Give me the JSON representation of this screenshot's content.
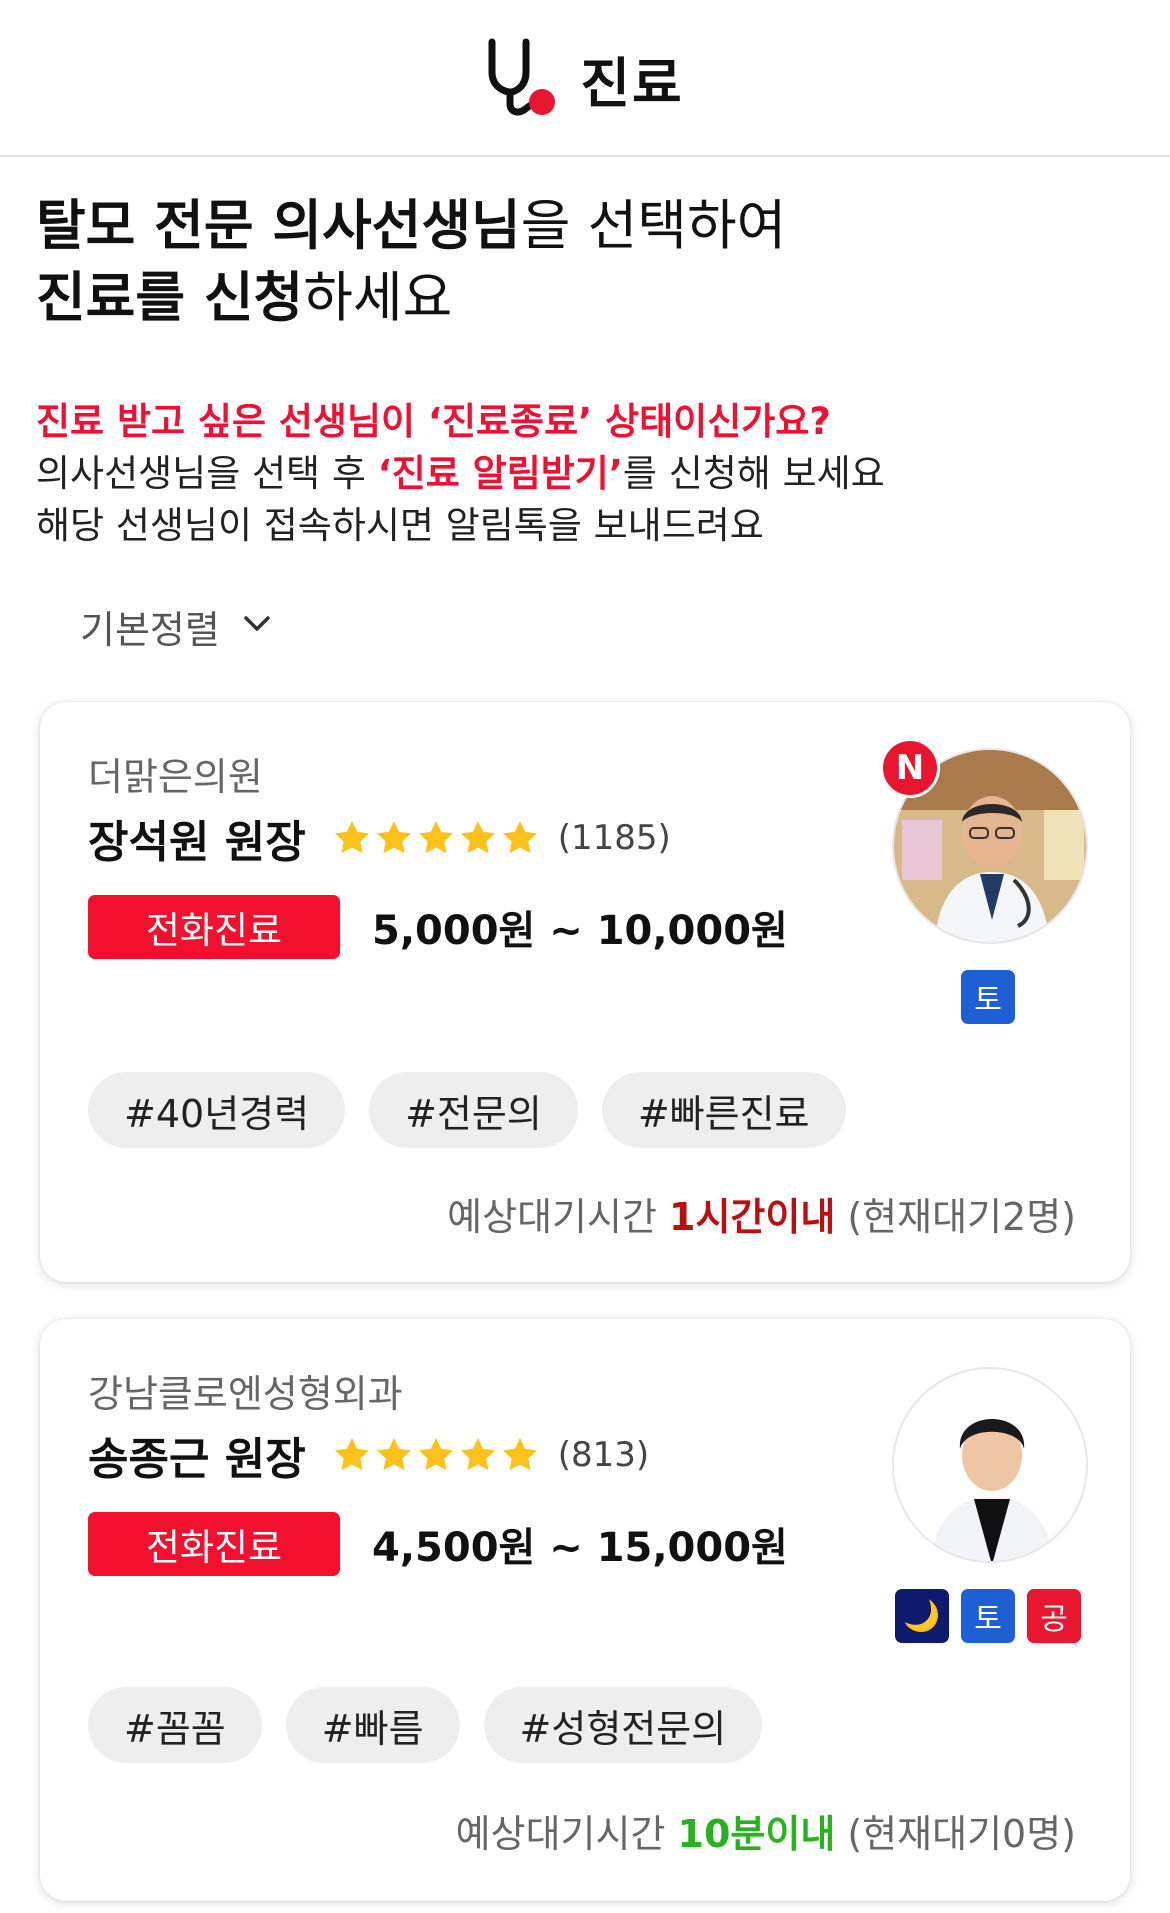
{
  "header": {
    "title": "진료",
    "logo_icon": "stethoscope-icon",
    "accent": "#e8172f"
  },
  "intro": {
    "line1_bold": "탈모 전문 의사선생님",
    "line1_rest": "을 선택하여",
    "line2_bold": "진료를 신청",
    "line2_rest": "하세요"
  },
  "notice": {
    "line1": "진료 받고 싶은 선생님이 ‘진료종료’ 상태이신가요?",
    "line2_pre": "의사선생님을 선택 후 ",
    "line2_highlight": "‘진료 알림받기’",
    "line2_post": "를 신청해 보세요",
    "line3": "해당 선생님이 접속하시면 알림톡을 보내드려요"
  },
  "sort": {
    "label": "기본정렬",
    "icon": "chevron-down-icon"
  },
  "doctors": [
    {
      "clinic": "더맑은의원",
      "name": "장석원 원장",
      "rating_stars": 5,
      "rating_count": "(1185)",
      "consult_type": "전화진료",
      "price": "5,000원 ~ 10,000원",
      "new_badge": "N",
      "days": [
        "토"
      ],
      "tags": [
        "#40년경력",
        "#전문의",
        "#빠른진료"
      ],
      "wait_label": "예상대기시간 ",
      "wait_value": "1시간이내",
      "wait_queue": " (현재대기2명)"
    },
    {
      "clinic": "강남클로엔성형외과",
      "name": "송종근 원장",
      "rating_stars": 5,
      "rating_count": "(813)",
      "consult_type": "전화진료",
      "price": "4,500원 ~ 15,000원",
      "days": [
        "🌙",
        "토",
        "공"
      ],
      "tags": [
        "#꼼꼼",
        "#빠름",
        "#성형전문의"
      ],
      "wait_label": "예상대기시간 ",
      "wait_value": "10분이내",
      "wait_queue": " (현재대기0명)"
    }
  ]
}
